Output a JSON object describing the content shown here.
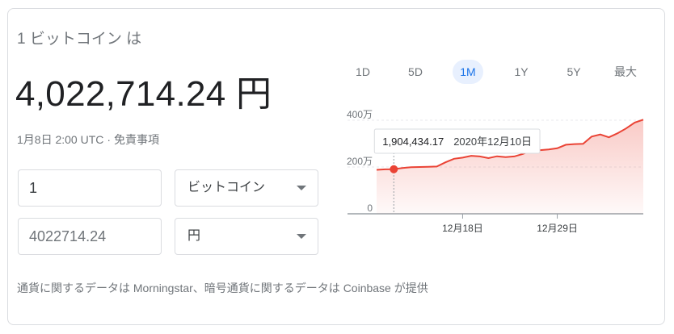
{
  "header": {
    "label": "1 ビットコイン は"
  },
  "price": {
    "value": "4,022,714.24 円"
  },
  "meta": {
    "timestamp": "1月8日 2:00 UTC",
    "separator": "·",
    "disclaimer": "免責事項"
  },
  "converter": {
    "amount_from": "1",
    "currency_from": "ビットコイン",
    "amount_to": "4022714.24",
    "currency_to": "円"
  },
  "ranges": [
    {
      "label": "1D",
      "active": false
    },
    {
      "label": "5D",
      "active": false
    },
    {
      "label": "1M",
      "active": true
    },
    {
      "label": "1Y",
      "active": false
    },
    {
      "label": "5Y",
      "active": false
    },
    {
      "label": "最大",
      "active": false
    }
  ],
  "tooltip": {
    "value": "1,904,434.17",
    "date": "2020年12月10日"
  },
  "colors": {
    "line": "#ea4335",
    "accent": "#1a73e8",
    "muted": "#70757a"
  },
  "chart_data": {
    "type": "area",
    "y_ticks": [
      {
        "value": 0,
        "label": "0"
      },
      {
        "value": 2000000,
        "label": "200万"
      },
      {
        "value": 4000000,
        "label": "400万"
      }
    ],
    "x_ticks": [
      {
        "date": "2020-12-18",
        "label": "12月18日"
      },
      {
        "date": "2020-12-29",
        "label": "12月29日"
      }
    ],
    "ylim": [
      0,
      4000000
    ],
    "grid": true,
    "x": [
      "2020-12-08",
      "2020-12-09",
      "2020-12-10",
      "2020-12-11",
      "2020-12-12",
      "2020-12-13",
      "2020-12-14",
      "2020-12-15",
      "2020-12-16",
      "2020-12-17",
      "2020-12-18",
      "2020-12-19",
      "2020-12-20",
      "2020-12-21",
      "2020-12-22",
      "2020-12-23",
      "2020-12-24",
      "2020-12-25",
      "2020-12-26",
      "2020-12-27",
      "2020-12-28",
      "2020-12-29",
      "2020-12-30",
      "2020-12-31",
      "2021-01-01",
      "2021-01-02",
      "2021-01-03",
      "2021-01-04",
      "2021-01-05",
      "2021-01-06",
      "2021-01-07",
      "2021-01-08"
    ],
    "series": [
      {
        "values": [
          1880000,
          1900000,
          1904434,
          1960000,
          1990000,
          2000000,
          2010000,
          2020000,
          2200000,
          2350000,
          2400000,
          2480000,
          2450000,
          2380000,
          2460000,
          2420000,
          2450000,
          2560000,
          2700000,
          2720000,
          2750000,
          2800000,
          2950000,
          2980000,
          2990000,
          3300000,
          3390000,
          3270000,
          3440000,
          3650000,
          3900000,
          4022714
        ]
      }
    ],
    "highlight_index": 2
  },
  "footer": {
    "text": "通貨に関するデータは Morningstar、暗号通貨に関するデータは Coinbase が提供"
  }
}
